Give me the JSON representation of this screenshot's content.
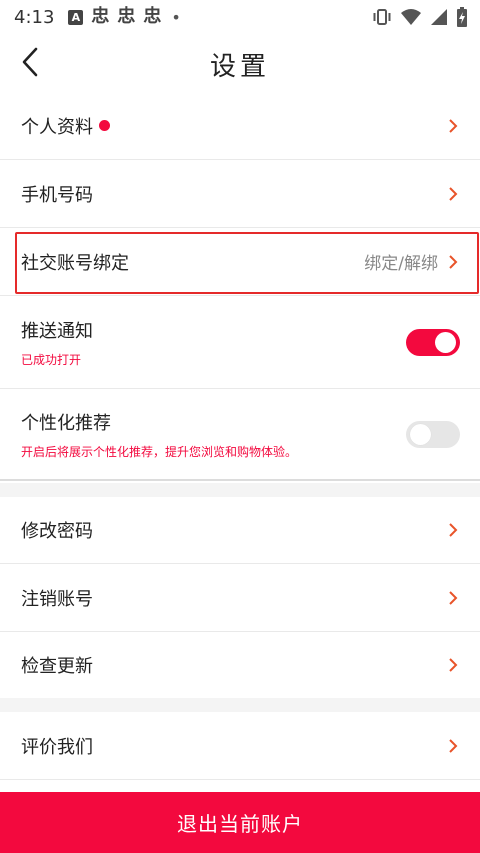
{
  "status_bar": {
    "time": "4:13",
    "a_badge": "A",
    "glyphs": [
      "忠",
      "忠",
      "忠"
    ],
    "dot": "•"
  },
  "header": {
    "title": "设置"
  },
  "settings": {
    "profile": {
      "label": "个人资料"
    },
    "phone": {
      "label": "手机号码"
    },
    "social": {
      "label": "社交账号绑定",
      "value": "绑定/解绑"
    },
    "push": {
      "label": "推送通知",
      "subtitle": "已成功打开",
      "enabled": true
    },
    "personalized": {
      "label": "个性化推荐",
      "subtitle": "开启后将展示个性化推荐，提升您浏览和购物体验。",
      "enabled": false
    },
    "password": {
      "label": "修改密码"
    },
    "cancel_account": {
      "label": "注销账号"
    },
    "check_update": {
      "label": "检查更新"
    },
    "rate_us": {
      "label": "评价我们"
    }
  },
  "logout": {
    "label": "退出当前账户"
  },
  "colors": {
    "accent": "#f3093e",
    "chevron": "#e8542a",
    "highlight": "#e52a2a"
  }
}
